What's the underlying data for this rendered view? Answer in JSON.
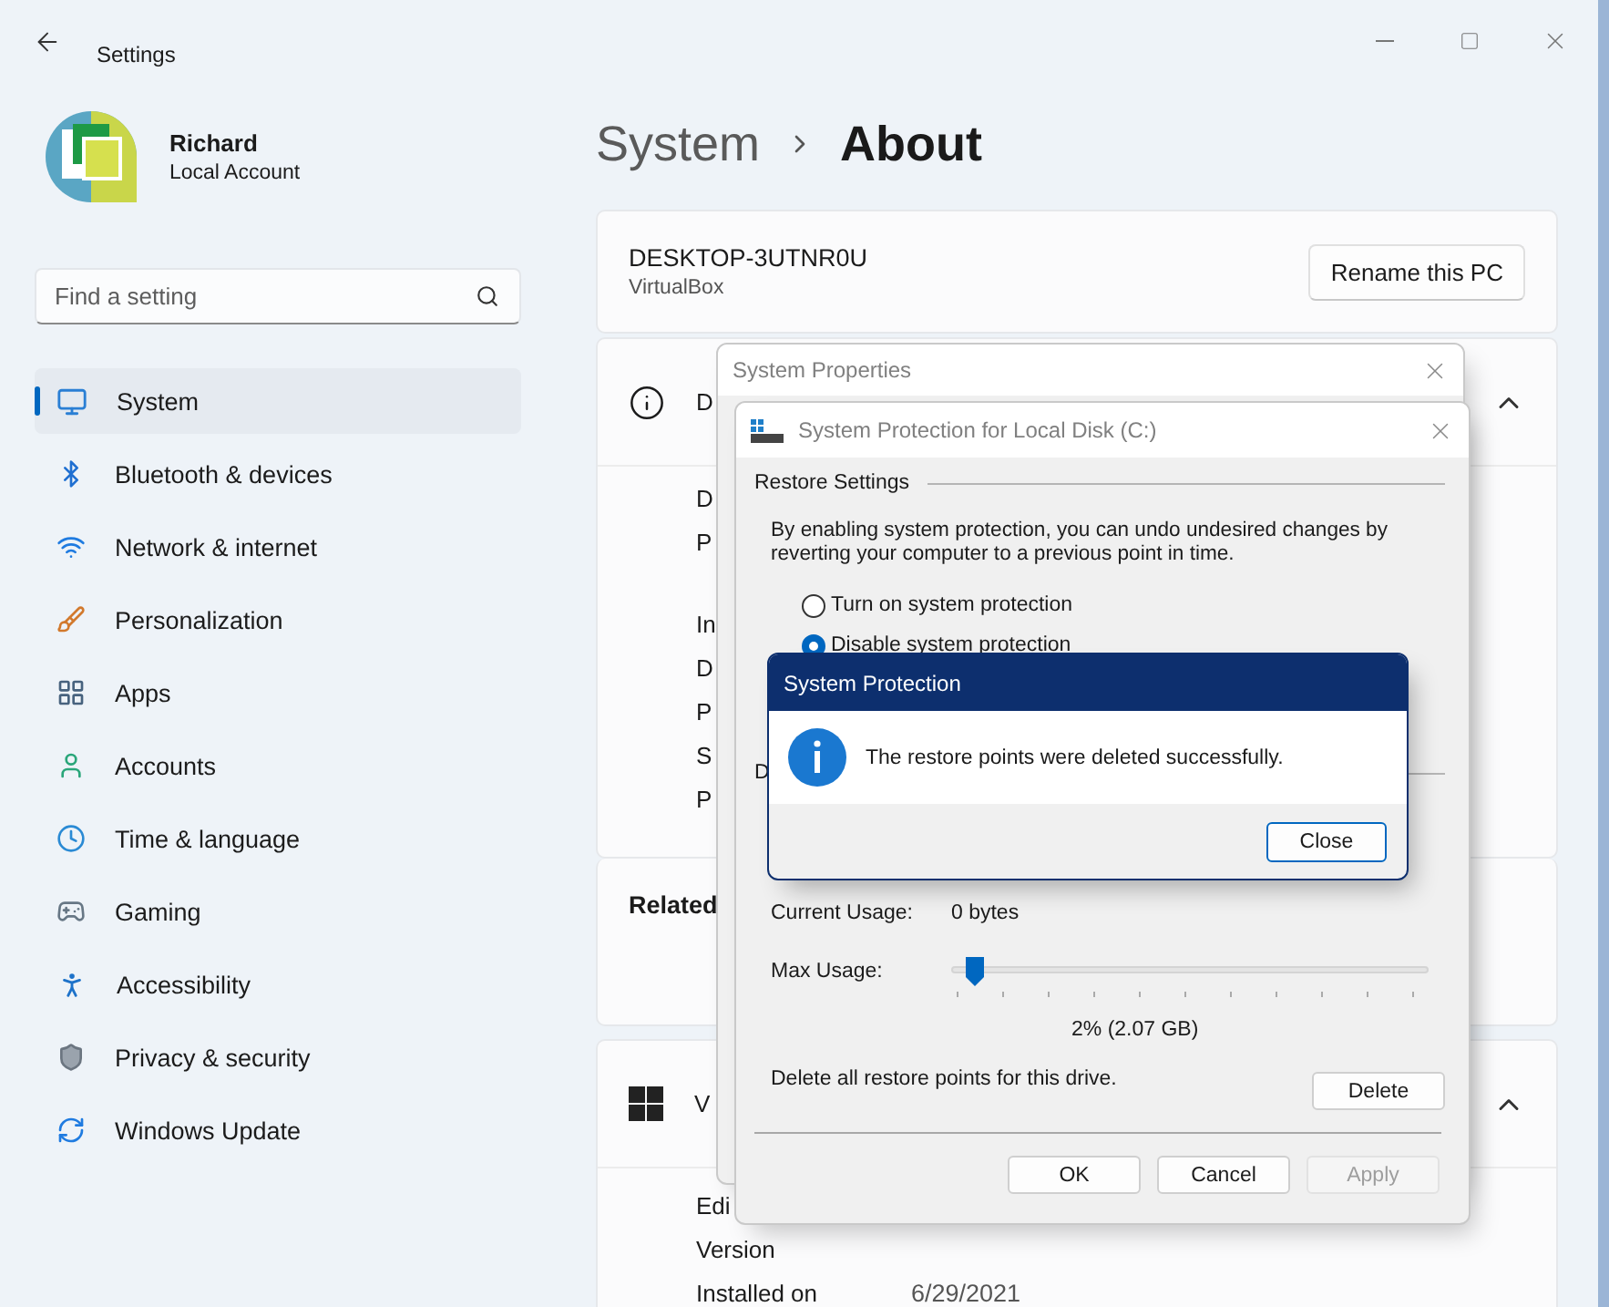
{
  "window": {
    "title": "Settings"
  },
  "profile": {
    "name": "Richard",
    "account": "Local Account"
  },
  "search": {
    "placeholder": "Find a setting"
  },
  "nav": [
    {
      "label": "System",
      "selected": true
    },
    {
      "label": "Bluetooth & devices",
      "selected": false
    },
    {
      "label": "Network & internet",
      "selected": false
    },
    {
      "label": "Personalization",
      "selected": false
    },
    {
      "label": "Apps",
      "selected": false
    },
    {
      "label": "Accounts",
      "selected": false
    },
    {
      "label": "Time & language",
      "selected": false
    },
    {
      "label": "Gaming",
      "selected": false
    },
    {
      "label": "Accessibility",
      "selected": false
    },
    {
      "label": "Privacy & security",
      "selected": false
    },
    {
      "label": "Windows Update",
      "selected": false
    }
  ],
  "breadcrumb": {
    "parent": "System",
    "current": "About"
  },
  "pc_card": {
    "name": "DESKTOP-3UTNR0U",
    "model": "VirtualBox",
    "button": "Rename this PC"
  },
  "device_specs": {
    "title": "D",
    "expanded": true,
    "groups": [
      [
        "D",
        "P"
      ],
      [
        "In",
        "D",
        "P",
        "S",
        "P"
      ]
    ]
  },
  "related": {
    "title": "Related"
  },
  "windows_specs": {
    "title": "V",
    "expanded": true,
    "rows": [
      {
        "label": "Edi"
      },
      {
        "label": "Version"
      },
      {
        "label": "Installed on",
        "value": "6/29/2021"
      }
    ]
  },
  "system_properties": {
    "title": "System Properties"
  },
  "protection_dialog": {
    "title": "System Protection for Local Disk (C:)",
    "restore_group": "Restore Settings",
    "description": "By enabling system protection, you can undo undesired changes by reverting your computer to a previous point in time.",
    "options": [
      {
        "label": "Turn on system protection",
        "selected": false
      },
      {
        "label": "Disable system protection",
        "selected": true
      }
    ],
    "disk_group": "D",
    "current_usage_label": "Current Usage:",
    "current_usage": "0 bytes",
    "max_usage_label": "Max Usage:",
    "max_usage": {
      "level": 0.02
    },
    "max_usage_reading": "2% (2.07 GB)",
    "delete_text": "Delete all restore points for this drive.",
    "delete_button": "Delete",
    "buttons": [
      {
        "label": "OK",
        "disabled": false
      },
      {
        "label": "Cancel",
        "disabled": false
      },
      {
        "label": "Apply",
        "disabled": true
      }
    ]
  },
  "message_box": {
    "title": "System Protection",
    "message": "The restore points were deleted successfully.",
    "button": "Close"
  }
}
